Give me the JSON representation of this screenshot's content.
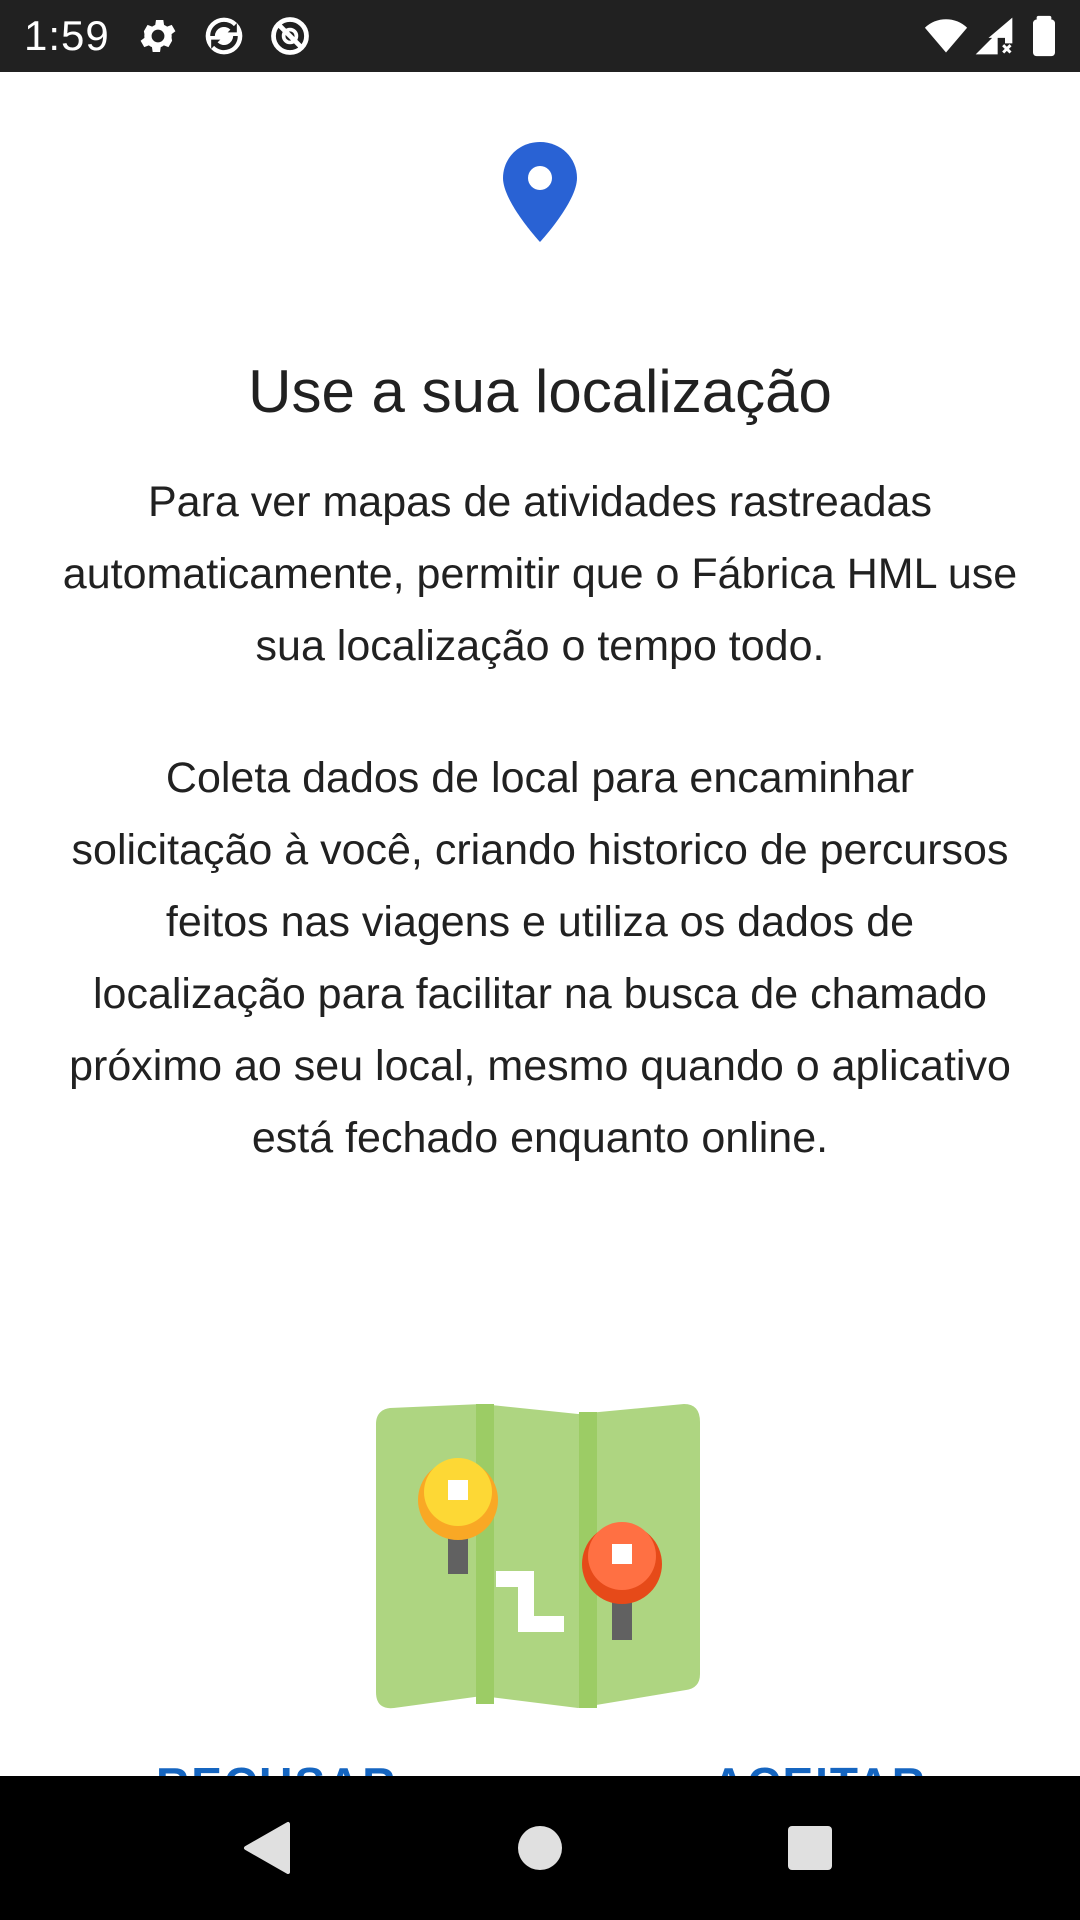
{
  "status_bar": {
    "time": "1:59",
    "left_icons": [
      "gear-icon",
      "sync-icon",
      "do-not-disturb-icon"
    ],
    "right_icons": [
      "wifi-icon",
      "signal-icon",
      "battery-icon"
    ]
  },
  "content": {
    "pin_icon": "location-pin-icon",
    "pin_color": "#2962d4",
    "title": "Use a sua localização",
    "paragraph1": "Para ver mapas de atividades rastreadas automaticamente, permitir que o Fábrica HML use sua localização o tempo todo.",
    "paragraph2": "Coleta dados de local para encaminhar solicitação à você, criando historico de percursos feitos nas viagens e utiliza os dados de localização para facilitar na busca de chamado próximo ao seu local, mesmo quando o aplicativo está fechado enquanto online.",
    "illustration_icon": "folded-map-icon"
  },
  "actions": {
    "refuse_label": "RECUSAR",
    "accept_label": "ACEITAR",
    "color": "#1565c0"
  },
  "nav_bar": {
    "icons": [
      "back-icon",
      "home-icon",
      "recents-icon"
    ]
  }
}
